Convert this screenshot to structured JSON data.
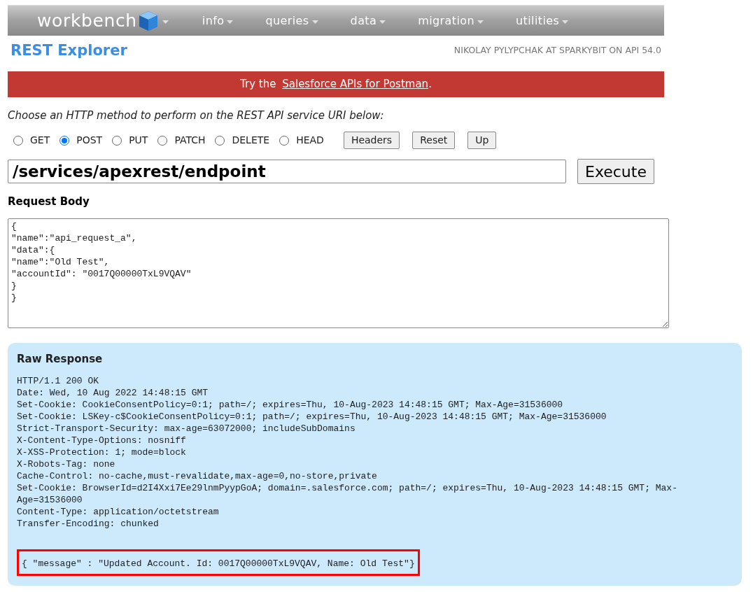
{
  "navbar": {
    "logo": "workbench",
    "menus": [
      "info",
      "queries",
      "data",
      "migration",
      "utilities"
    ]
  },
  "page_title": "REST Explorer",
  "user_info": "NIKOLAY PYLYPCHAK AT SPARKYBIT ON API 54.0",
  "banner": {
    "prefix": "Try the ",
    "link": "Salesforce APIs for Postman",
    "suffix": "."
  },
  "instruction": "Choose an HTTP method to perform on the REST API service URI below:",
  "methods": [
    {
      "label": "GET",
      "selected": false
    },
    {
      "label": "POST",
      "selected": true
    },
    {
      "label": "PUT",
      "selected": false
    },
    {
      "label": "PATCH",
      "selected": false
    },
    {
      "label": "DELETE",
      "selected": false
    },
    {
      "label": "HEAD",
      "selected": false
    }
  ],
  "method_buttons": [
    "Headers",
    "Reset",
    "Up"
  ],
  "uri": "/services/apexrest/endpoint",
  "execute_button": "Execute",
  "request_body": {
    "label": "Request Body",
    "value": "{\n\"name\":\"api_request_a\",\n\"data\":{\n\"name\":\"Old Test\",\n\"accountId\": \"0017Q00000TxL9VQAV\"\n}\n}"
  },
  "response": {
    "title": "Raw Response",
    "headers": [
      "HTTP/1.1 200 OK",
      "Date: Wed, 10 Aug 2022 14:48:15 GMT",
      "Set-Cookie: CookieConsentPolicy=0:1; path=/; expires=Thu, 10-Aug-2023 14:48:15 GMT; Max-Age=31536000",
      "Set-Cookie: LSKey-c$CookieConsentPolicy=0:1; path=/; expires=Thu, 10-Aug-2023 14:48:15 GMT; Max-Age=31536000",
      "Strict-Transport-Security: max-age=63072000; includeSubDomains",
      "X-Content-Type-Options: nosniff",
      "X-XSS-Protection: 1; mode=block",
      "X-Robots-Tag: none",
      "Cache-Control: no-cache,must-revalidate,max-age=0,no-store,private",
      "Set-Cookie: BrowserId=d2I4Xxi7Ee29lnmPyypGoA; domain=.salesforce.com; path=/; expires=Thu, 10-Aug-2023 14:48:15 GMT; Max-Age=31536000",
      "Content-Type: application/octetstream",
      "Transfer-Encoding: chunked"
    ],
    "body": "{ \"message\" : \"Updated Account. Id: 0017Q00000TxL9VQAV, Name: Old Test\"}"
  }
}
